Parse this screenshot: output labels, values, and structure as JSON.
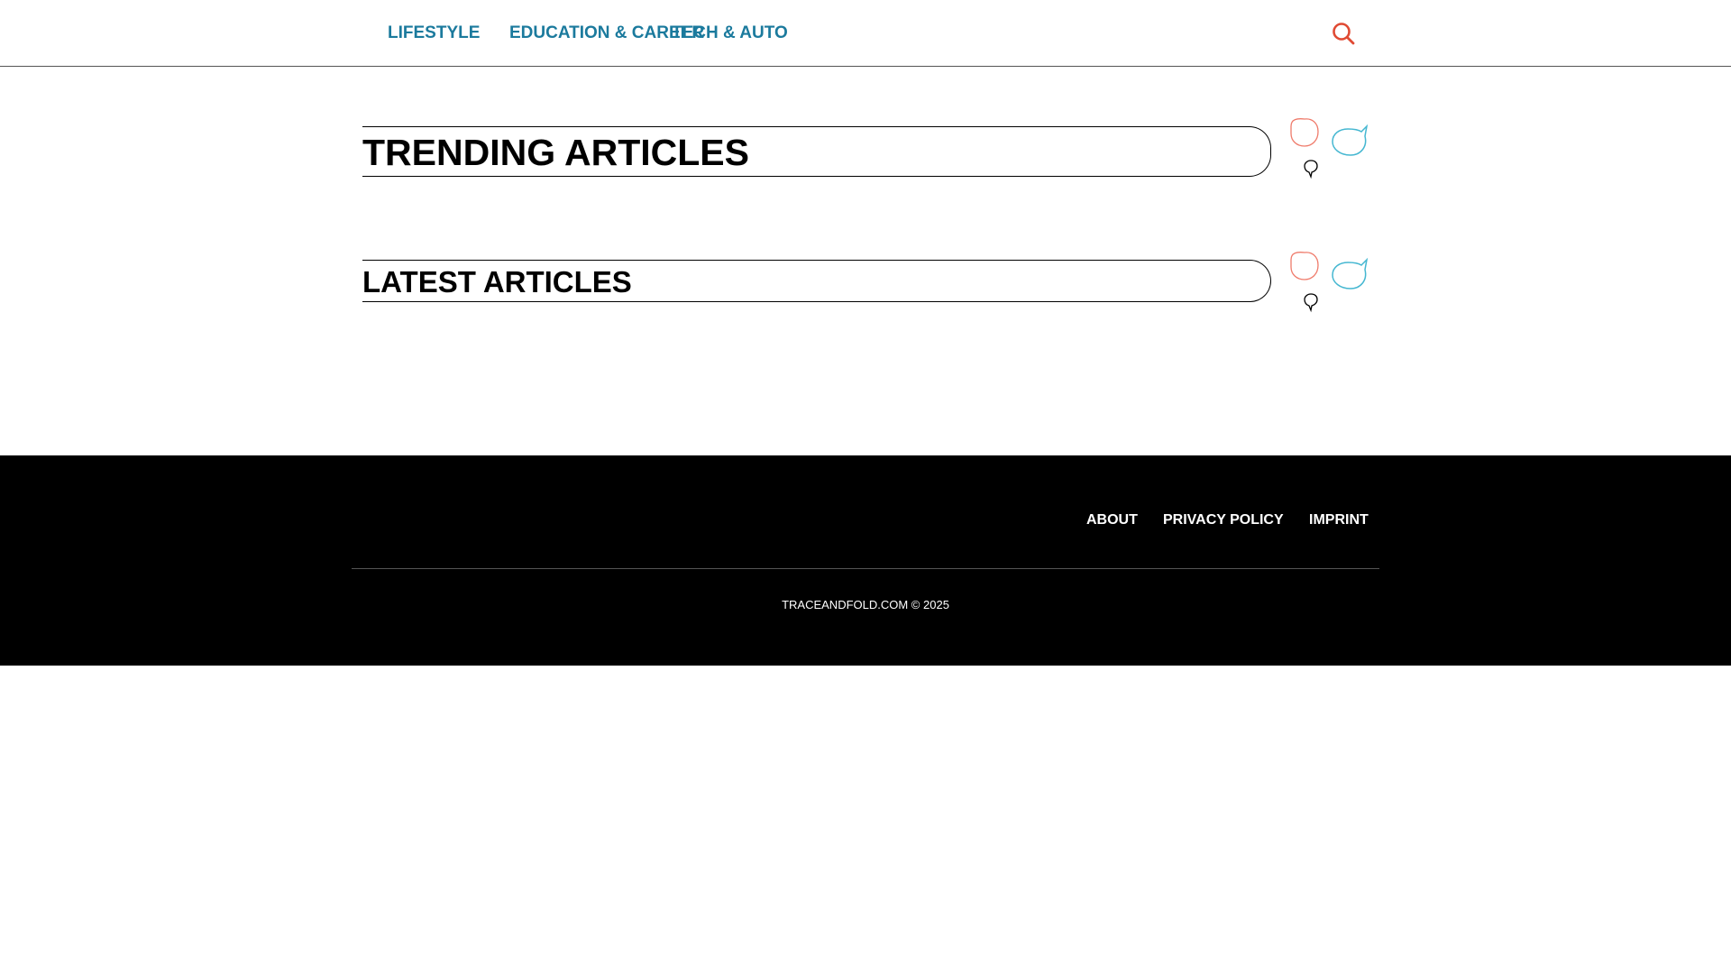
{
  "nav": {
    "items": [
      {
        "label": "LIFESTYLE"
      },
      {
        "label": "EDUCATION & CAREER"
      },
      {
        "label": "TECH & AUTO"
      }
    ]
  },
  "sections": {
    "trending": {
      "title": "TRENDING ARTICLES"
    },
    "latest": {
      "title": "LATEST ARTICLES"
    }
  },
  "footer": {
    "links": [
      {
        "label": "ABOUT"
      },
      {
        "label": "PRIVACY POLICY"
      },
      {
        "label": "IMPRINT"
      }
    ],
    "copyright": "TRACEANDFOLD.COM © 2025"
  },
  "icons": {
    "search": "search-icon",
    "decoration": "speech-bubbles-icon"
  },
  "colors": {
    "nav_text": "#1b7a9d",
    "search_icon": "#e04a33",
    "bubble_coral": "#ef7b6b",
    "bubble_cyan": "#45b7d1",
    "footer_bg": "#000000"
  }
}
